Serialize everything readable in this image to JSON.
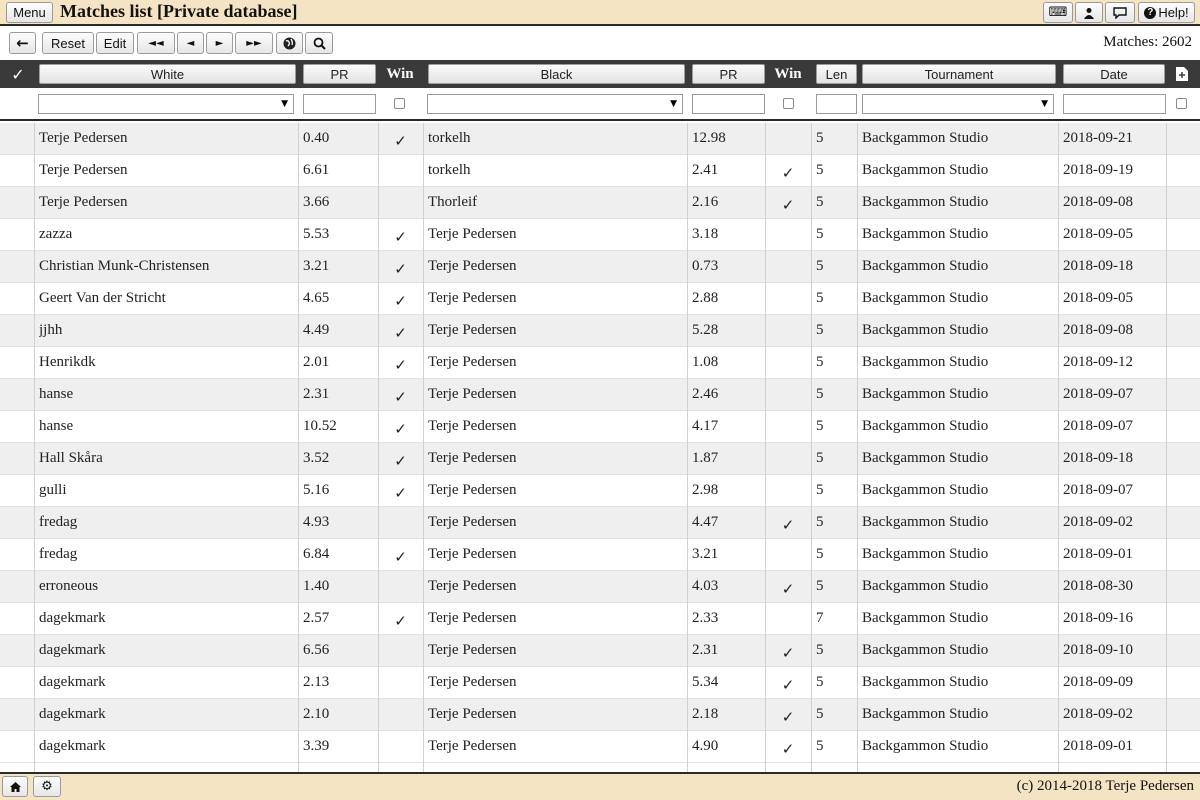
{
  "topbar": {
    "menu_label": "Menu",
    "title": "Matches list [Private database]",
    "help_label": "Help!",
    "help_icon": "?",
    "keyboard_icon": "⌨",
    "user_icon": "👤",
    "chat_icon": "💬"
  },
  "toolbar": {
    "back_icon": "←",
    "reset_label": "Reset",
    "edit_label": "Edit",
    "first_icon": "◄◄",
    "prev_icon": "◄",
    "next_icon": "►",
    "last_icon": "►►",
    "globe_icon": "◉",
    "search_icon": "⚲",
    "matches_text": "Matches: 2602"
  },
  "header": {
    "select_all_icon": "✓",
    "white": "White",
    "pr1": "PR",
    "win1": "Win",
    "black": "Black",
    "pr2": "PR",
    "win2": "Win",
    "len": "Len",
    "tournament": "Tournament",
    "date": "Date",
    "export_icon": "🗎"
  },
  "filters": {
    "white_select": "▼",
    "black_select": "▼",
    "tournament_select": "▼",
    "pr1_value": "",
    "pr2_value": "",
    "len_value": "",
    "date_value": ""
  },
  "check_glyph": "✓",
  "rows": [
    {
      "white": "Terje Pedersen",
      "pr1": "0.40",
      "win1": true,
      "black": "torkelh",
      "pr2": "12.98",
      "win2": false,
      "len": "5",
      "tournament": "Backgammon Studio",
      "date": "2018-09-21"
    },
    {
      "white": "Terje Pedersen",
      "pr1": "6.61",
      "win1": false,
      "black": "torkelh",
      "pr2": "2.41",
      "win2": true,
      "len": "5",
      "tournament": "Backgammon Studio",
      "date": "2018-09-19"
    },
    {
      "white": "Terje Pedersen",
      "pr1": "3.66",
      "win1": false,
      "black": "Thorleif",
      "pr2": "2.16",
      "win2": true,
      "len": "5",
      "tournament": "Backgammon Studio",
      "date": "2018-09-08"
    },
    {
      "white": "zazza",
      "pr1": "5.53",
      "win1": true,
      "black": "Terje Pedersen",
      "pr2": "3.18",
      "win2": false,
      "len": "5",
      "tournament": "Backgammon Studio",
      "date": "2018-09-05"
    },
    {
      "white": "Christian Munk-Christensen",
      "pr1": "3.21",
      "win1": true,
      "black": "Terje Pedersen",
      "pr2": "0.73",
      "win2": false,
      "len": "5",
      "tournament": "Backgammon Studio",
      "date": "2018-09-18"
    },
    {
      "white": "Geert Van der Stricht",
      "pr1": "4.65",
      "win1": true,
      "black": "Terje Pedersen",
      "pr2": "2.88",
      "win2": false,
      "len": "5",
      "tournament": "Backgammon Studio",
      "date": "2018-09-05"
    },
    {
      "white": "jjhh",
      "pr1": "4.49",
      "win1": true,
      "black": "Terje Pedersen",
      "pr2": "5.28",
      "win2": false,
      "len": "5",
      "tournament": "Backgammon Studio",
      "date": "2018-09-08"
    },
    {
      "white": "Henrikdk",
      "pr1": "2.01",
      "win1": true,
      "black": "Terje Pedersen",
      "pr2": "1.08",
      "win2": false,
      "len": "5",
      "tournament": "Backgammon Studio",
      "date": "2018-09-12"
    },
    {
      "white": "hanse",
      "pr1": "2.31",
      "win1": true,
      "black": "Terje Pedersen",
      "pr2": "2.46",
      "win2": false,
      "len": "5",
      "tournament": "Backgammon Studio",
      "date": "2018-09-07"
    },
    {
      "white": "hanse",
      "pr1": "10.52",
      "win1": true,
      "black": "Terje Pedersen",
      "pr2": "4.17",
      "win2": false,
      "len": "5",
      "tournament": "Backgammon Studio",
      "date": "2018-09-07"
    },
    {
      "white": "Hall Skåra",
      "pr1": "3.52",
      "win1": true,
      "black": "Terje Pedersen",
      "pr2": "1.87",
      "win2": false,
      "len": "5",
      "tournament": "Backgammon Studio",
      "date": "2018-09-18"
    },
    {
      "white": "gulli",
      "pr1": "5.16",
      "win1": true,
      "black": "Terje Pedersen",
      "pr2": "2.98",
      "win2": false,
      "len": "5",
      "tournament": "Backgammon Studio",
      "date": "2018-09-07"
    },
    {
      "white": "fredag",
      "pr1": "4.93",
      "win1": false,
      "black": "Terje Pedersen",
      "pr2": "4.47",
      "win2": true,
      "len": "5",
      "tournament": "Backgammon Studio",
      "date": "2018-09-02"
    },
    {
      "white": "fredag",
      "pr1": "6.84",
      "win1": true,
      "black": "Terje Pedersen",
      "pr2": "3.21",
      "win2": false,
      "len": "5",
      "tournament": "Backgammon Studio",
      "date": "2018-09-01"
    },
    {
      "white": "erroneous",
      "pr1": "1.40",
      "win1": false,
      "black": "Terje Pedersen",
      "pr2": "4.03",
      "win2": true,
      "len": "5",
      "tournament": "Backgammon Studio",
      "date": "2018-08-30"
    },
    {
      "white": "dagekmark",
      "pr1": "2.57",
      "win1": true,
      "black": "Terje Pedersen",
      "pr2": "2.33",
      "win2": false,
      "len": "7",
      "tournament": "Backgammon Studio",
      "date": "2018-09-16"
    },
    {
      "white": "dagekmark",
      "pr1": "6.56",
      "win1": false,
      "black": "Terje Pedersen",
      "pr2": "2.31",
      "win2": true,
      "len": "5",
      "tournament": "Backgammon Studio",
      "date": "2018-09-10"
    },
    {
      "white": "dagekmark",
      "pr1": "2.13",
      "win1": false,
      "black": "Terje Pedersen",
      "pr2": "5.34",
      "win2": true,
      "len": "5",
      "tournament": "Backgammon Studio",
      "date": "2018-09-09"
    },
    {
      "white": "dagekmark",
      "pr1": "2.10",
      "win1": false,
      "black": "Terje Pedersen",
      "pr2": "2.18",
      "win2": true,
      "len": "5",
      "tournament": "Backgammon Studio",
      "date": "2018-09-02"
    },
    {
      "white": "dagekmark",
      "pr1": "3.39",
      "win1": false,
      "black": "Terje Pedersen",
      "pr2": "4.90",
      "win2": true,
      "len": "5",
      "tournament": "Backgammon Studio",
      "date": "2018-09-01"
    }
  ],
  "footer": {
    "home_icon": "⌂",
    "settings_icon": "⚙",
    "copyright": "(c) 2014-2018 Terje Pedersen"
  }
}
